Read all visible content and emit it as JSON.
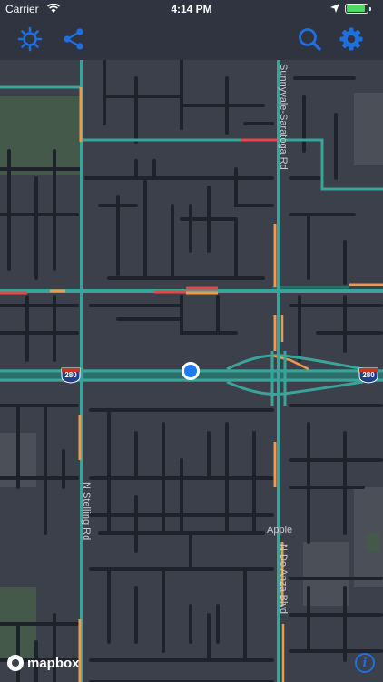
{
  "status_bar": {
    "carrier": "Carrier",
    "time": "4:14 PM",
    "battery_level": 0.9
  },
  "toolbar": {
    "left_icons": [
      "settings-sun-icon",
      "share-icon"
    ],
    "right_icons": [
      "search-icon",
      "gear-icon"
    ],
    "accent_color": "#1f6fe0"
  },
  "map": {
    "streets": {
      "sunnyvale_saratoga": "Sunnyvale-Saratoga Rd",
      "stelling": "N Stelling Rd",
      "de_anza": "N De Anza Blvd"
    },
    "shields": {
      "left": "280",
      "right": "280"
    },
    "poi": "Apple",
    "attribution": "mapbox",
    "info_glyph": "i"
  },
  "colors": {
    "road_teal": "#3aa39a",
    "road_orange": "#ee9a4d",
    "road_red": "#e0484a",
    "background": "#3b404a",
    "user_location": "#1f7cf0"
  }
}
